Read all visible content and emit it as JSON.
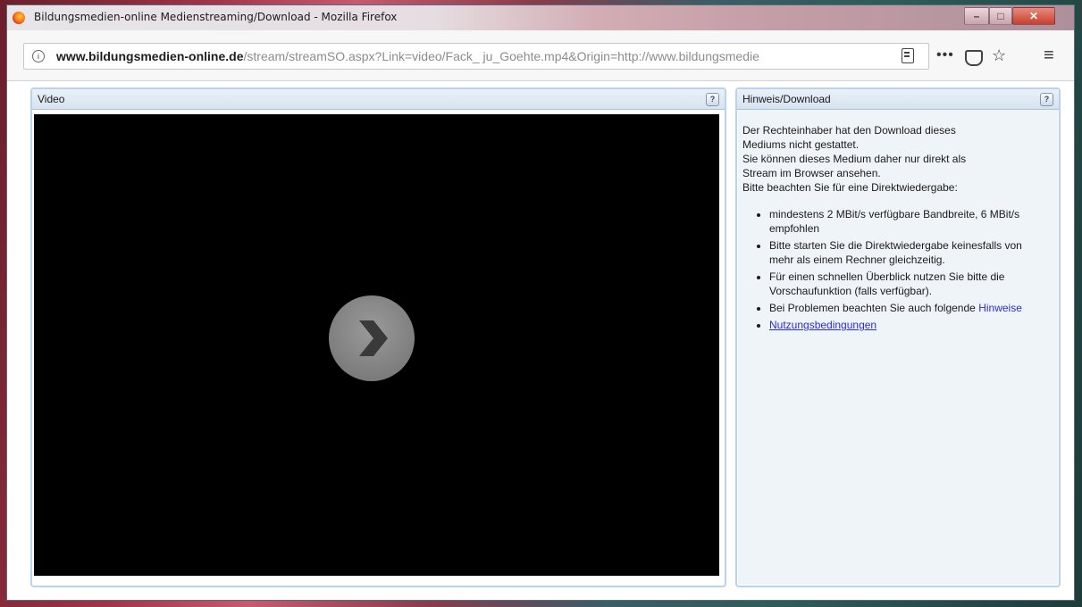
{
  "window": {
    "title": "Bildungsmedien-online Medienstreaming/Download - Mozilla Firefox",
    "minimize_label": "–",
    "maximize_label": "□",
    "close_label": "✕"
  },
  "navbar": {
    "url_domain": "www.bildungsmedien-online.de",
    "url_path": "/stream/streamSO.aspx?Link=video/Fack_ ju_Goehte.mp4&Origin=http://www.bildungsmedie",
    "url_prefix": "",
    "dots_label": "•••",
    "star_label": "☆",
    "menu_label": "≡"
  },
  "video_panel": {
    "title": "Video",
    "help_label": "?"
  },
  "info_panel": {
    "title": "Hinweis/Download",
    "help_label": "?",
    "lines": [
      "Der Rechteinhaber hat den Download dieses",
      "Mediums nicht gestattet.",
      "Sie können dieses Medium daher nur direkt als",
      "Stream im Browser ansehen.",
      "Bitte beachten Sie für eine Direktwiedergabe:"
    ],
    "bullets": [
      {
        "text": "mindestens 2 MBit/s verfügbare Bandbreite, 6 MBit/s empfohlen"
      },
      {
        "text": "Bitte starten Sie die Direktwiedergabe keinesfalls von mehr als einem Rechner gleichzeitig."
      },
      {
        "text": "Für einen schnellen Überblick nutzen Sie bitte die Vorschaufunktion (falls verfügbar)."
      },
      {
        "text": "Bei Problemen beachten Sie auch folgende",
        "link": "Hinweise"
      },
      {
        "link_underlined": "Nutzungsbedingungen"
      }
    ]
  }
}
